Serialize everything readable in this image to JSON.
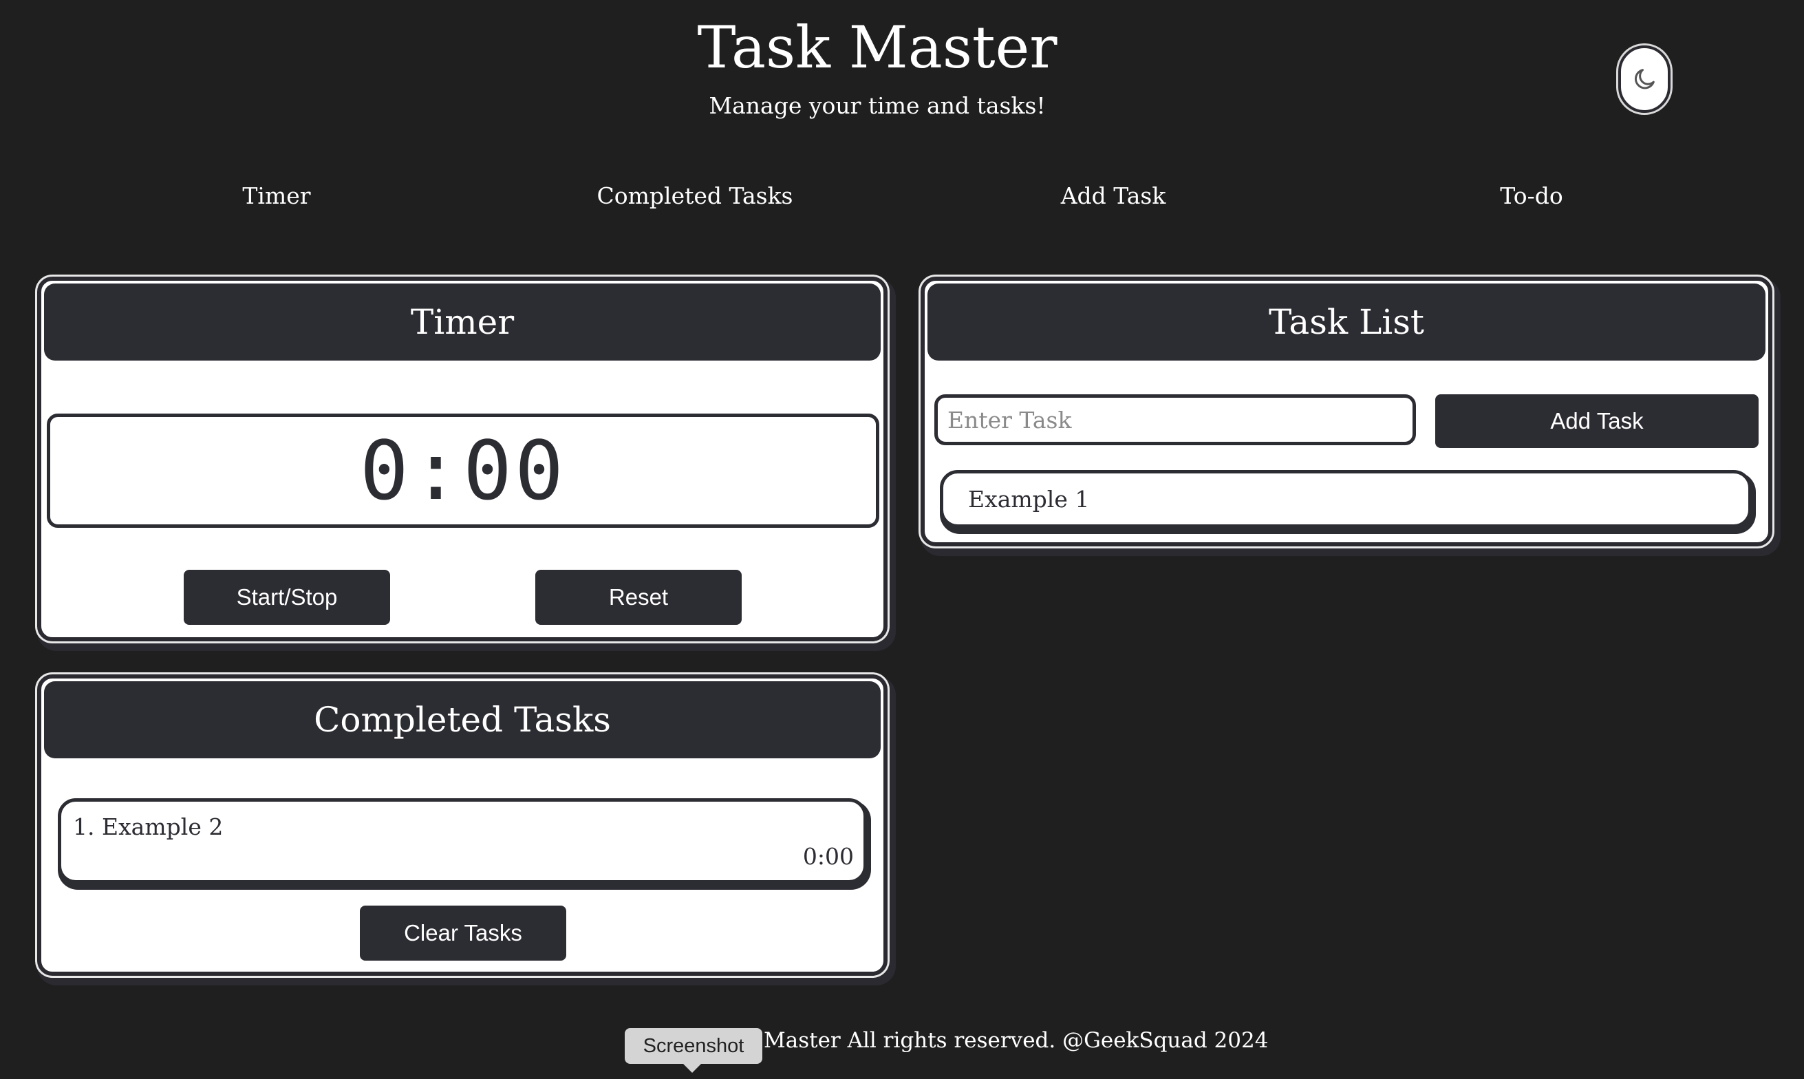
{
  "header": {
    "title": "Task Master",
    "subtitle": "Manage your time and tasks!",
    "theme_toggle_icon": "moon-icon"
  },
  "nav": {
    "items": [
      "Timer",
      "Completed Tasks",
      "Add Task",
      "To-do"
    ]
  },
  "timer_card": {
    "title": "Timer",
    "display": "0:00",
    "start_stop_label": "Start/Stop",
    "reset_label": "Reset"
  },
  "completed_card": {
    "title": "Completed Tasks",
    "items": [
      {
        "name": "1. Example 2",
        "time": "0:00"
      }
    ],
    "clear_label": "Clear Tasks"
  },
  "task_list_card": {
    "title": "Task List",
    "input_placeholder": "Enter Task",
    "add_label": "Add Task",
    "items": [
      "Example 1"
    ]
  },
  "footer": {
    "text": "Master All rights reserved. @GeekSquad 2024"
  },
  "tooltip": {
    "text": "Screenshot"
  },
  "colors": {
    "background": "#1f1f20",
    "card_header": "#2c2c33",
    "card": "#ffffff"
  }
}
